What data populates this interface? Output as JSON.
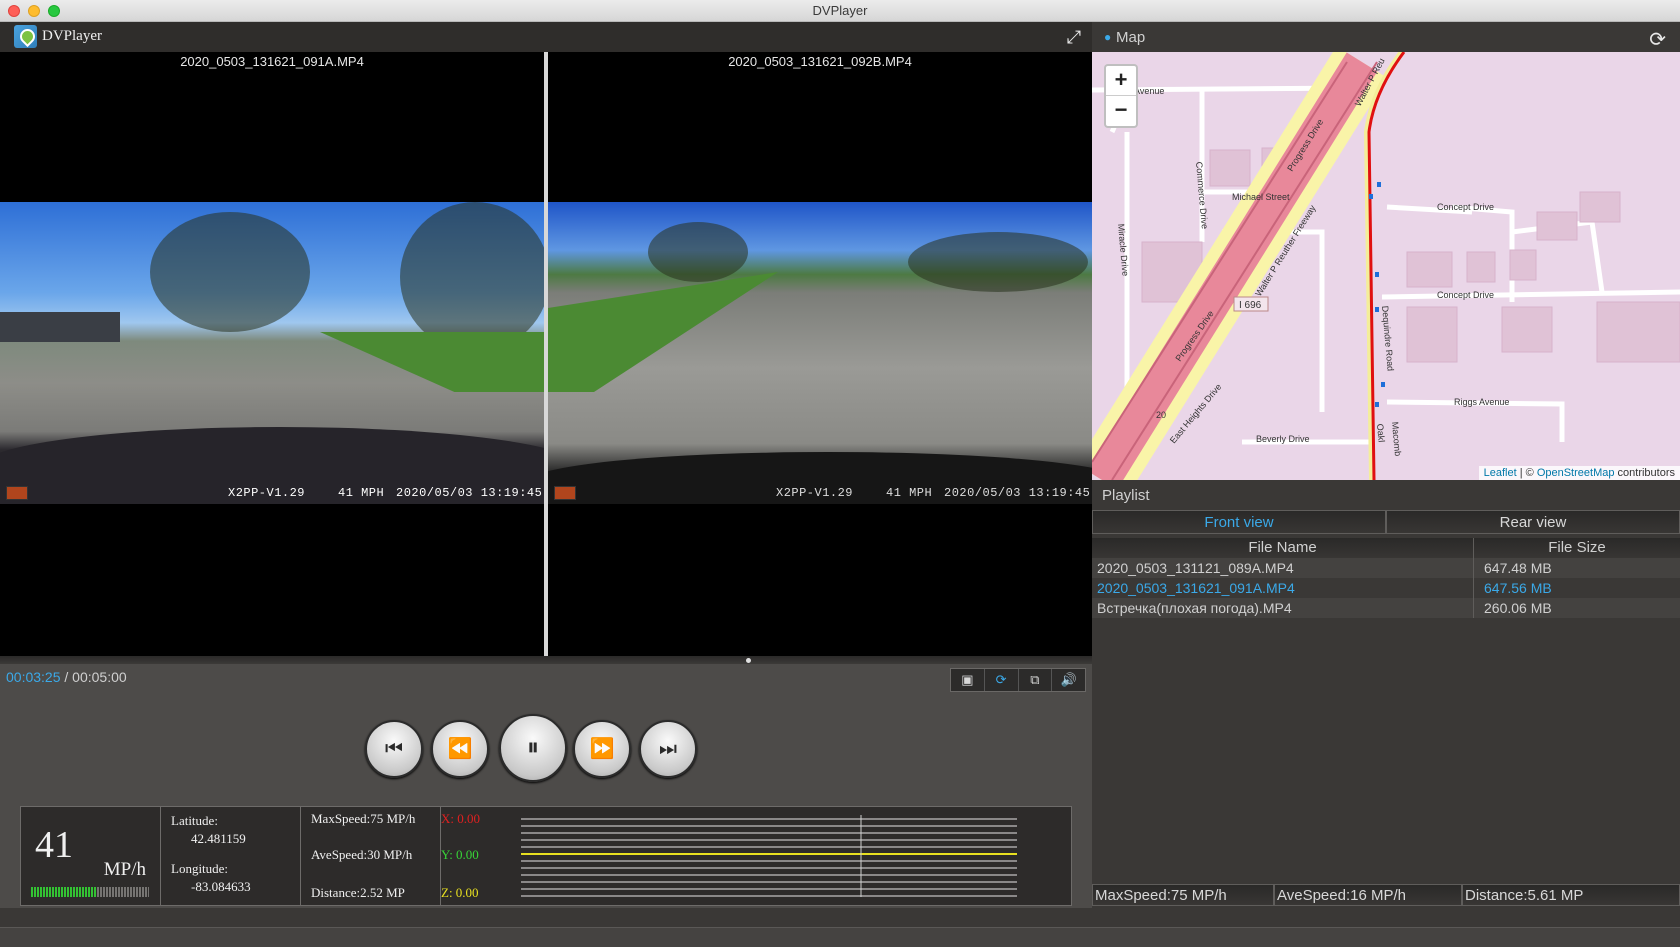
{
  "window": {
    "title": "DVPlayer"
  },
  "app": {
    "name": "DVPlayer"
  },
  "icons": {
    "logo": "dvplayer-logo-icon",
    "expand": "fullscreen-expand-icon",
    "map_pin": "map-pin-icon",
    "refresh": "refresh-icon"
  },
  "videos": {
    "front": {
      "title": "2020_0503_131621_091A.MP4",
      "overlay_fw": "X2PP-V1.29",
      "overlay_speed": "41 MPH",
      "overlay_datetime": "2020/05/03 13:19:45"
    },
    "rear": {
      "title": "2020_0503_131621_092B.MP4",
      "overlay_fw": "X2PP-V1.29",
      "overlay_speed": "41 MPH",
      "overlay_datetime": "2020/05/03 13:19:45"
    }
  },
  "playback": {
    "current_time": "00:03:25",
    "separator": " / ",
    "total_time": "00:05:00",
    "progress": 0.683,
    "tools": [
      {
        "name": "snapshot-icon",
        "glyph": "▣"
      },
      {
        "name": "rotate-icon",
        "glyph": "⟳"
      },
      {
        "name": "window-icon",
        "glyph": "⧉"
      },
      {
        "name": "volume-icon",
        "glyph": "🔊"
      }
    ],
    "buttons": [
      {
        "name": "skip-previous-icon",
        "glyph": "⏮"
      },
      {
        "name": "rewind-icon",
        "glyph": "⏪"
      },
      {
        "name": "pause-icon",
        "glyph": "⏸"
      },
      {
        "name": "fast-forward-icon",
        "glyph": "⏩"
      },
      {
        "name": "skip-next-icon",
        "glyph": "⏭"
      }
    ]
  },
  "telemetry": {
    "speed": "41",
    "speed_unit": "MP/h",
    "speed_fraction": 0.55,
    "latitude_label": "Latitude:",
    "latitude": "42.481159",
    "longitude_label": "Longitude:",
    "longitude": "-83.084633",
    "max_speed": "MaxSpeed:75 MP/h",
    "ave_speed": "AveSpeed:30 MP/h",
    "distance": "Distance:2.52 MP",
    "x": "X: 0.00",
    "y": "Y: 0.00",
    "z": "Z: 0.00",
    "colors": {
      "x": "#e02020",
      "y": "#37d437",
      "z": "#e8e020"
    }
  },
  "map": {
    "title": "Map",
    "zoom_in": "+",
    "zoom_out": "−",
    "attribution": {
      "leaflet": "Leaflet",
      "sep": " | © ",
      "osm": "OpenStreetMap",
      "suffix": " contributors"
    },
    "streets": {
      "avenue": "Avenue",
      "michael": "Michael Street",
      "commerce": "Commerce Drive",
      "miracle": "Miracle Drive",
      "progress_top": "Progress Drive",
      "progress_bottom": "Progress Drive",
      "freeway": "Walter P Reuther Freeway",
      "walter_top": "Walter P Reu",
      "i696": "I 696",
      "concept_top": "Concept Drive",
      "concept_mid": "Concept Drive",
      "east_heights": "East Heights Drive",
      "riggs": "Riggs Avenue",
      "beverly": "Beverly Drive",
      "route20": "20",
      "dequindre": "Dequindre Road",
      "oakl": "Oakl",
      "macomb": "Macomb"
    }
  },
  "playlist": {
    "title": "Playlist",
    "tabs": [
      "Front view",
      "Rear view"
    ],
    "columns": [
      "File Name",
      "File Size"
    ],
    "rows": [
      {
        "name": "2020_0503_131121_089A.MP4",
        "size": "647.48 MB"
      },
      {
        "name": "2020_0503_131621_091A.MP4",
        "size": "647.56 MB"
      },
      {
        "name": "Встречка(плохая погода).MP4",
        "size": "260.06 MB"
      }
    ]
  },
  "summary": {
    "max_speed": "MaxSpeed:75 MP/h",
    "ave_speed": "AveSpeed:16 MP/h",
    "distance": "Distance:5.61 MP"
  },
  "colors": {
    "accent": "#3ba9e8",
    "panel": "#3a3836"
  }
}
